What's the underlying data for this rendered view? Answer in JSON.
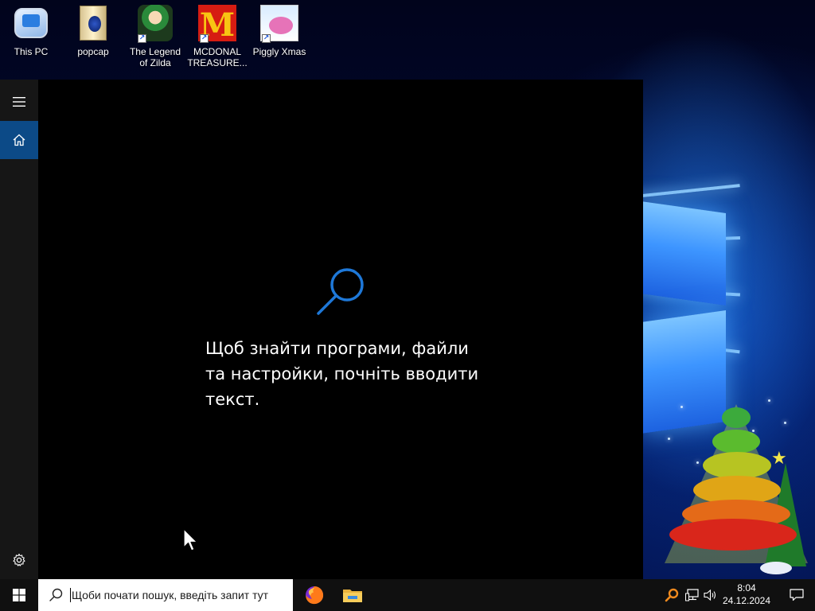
{
  "desktop": {
    "icons": [
      {
        "label": "This PC",
        "icon": "computer-icon",
        "shortcut": false
      },
      {
        "label": "popcap",
        "icon": "folder-icon",
        "shortcut": false
      },
      {
        "label": "The Legend\nof Zilda",
        "icon": "game-zilda-icon",
        "shortcut": true
      },
      {
        "label": "MCDONAL\nTREASURE...",
        "icon": "mcdonalds-icon",
        "shortcut": true
      },
      {
        "label": "Piggly Xmas",
        "icon": "piggly-icon",
        "shortcut": true
      }
    ],
    "wallpaper": "windows-10-hero-with-christmas-tree"
  },
  "start_menu": {
    "rail": {
      "menu_icon": "hamburger-icon",
      "home_icon": "home-icon",
      "settings_icon": "gear-icon",
      "active_color": "#0c4a87"
    },
    "illustration_icon": "search-icon",
    "hint": "Щоб знайти програми, файли та настройки, почніть вводити текст.",
    "accent": "#1e78d8"
  },
  "taskbar": {
    "start_icon": "windows-logo-icon",
    "search": {
      "placeholder": "Щоби почати пошук, введіть запит тут"
    },
    "pinned": [
      {
        "name": "Firefox",
        "icon": "firefox-icon"
      },
      {
        "name": "File Explorer",
        "icon": "file-explorer-icon"
      }
    ],
    "tray": {
      "icons": [
        "search-tray-icon",
        "network-icon",
        "volume-icon"
      ],
      "time": "8:04",
      "date": "24.12.2024",
      "notifications_icon": "notification-icon"
    }
  }
}
